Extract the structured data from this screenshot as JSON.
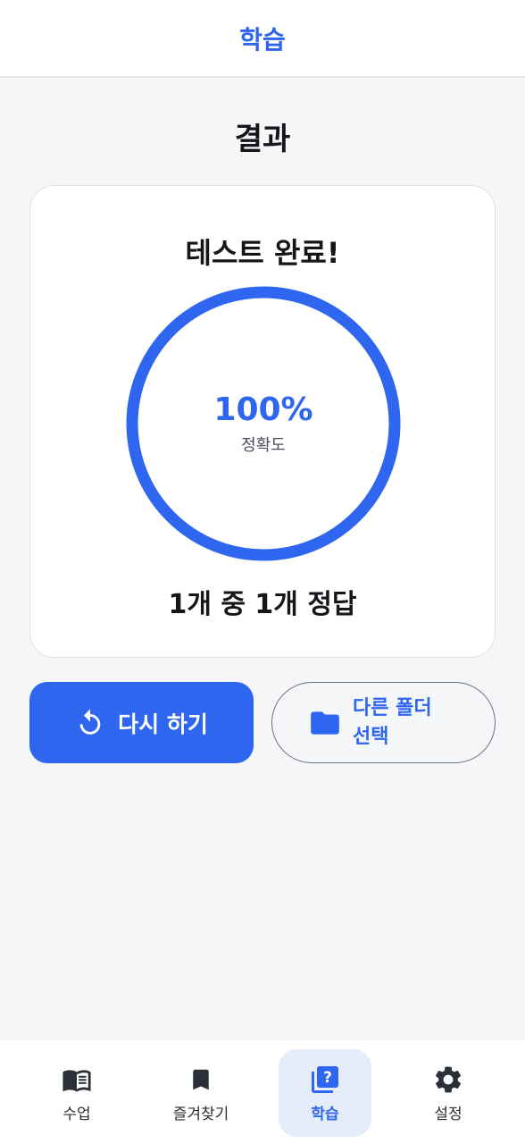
{
  "app_bar": {
    "title": "학습"
  },
  "page": {
    "heading": "결과"
  },
  "result_card": {
    "title": "테스트 완료!",
    "accuracy_text": "100%",
    "accuracy_caption": "정확도",
    "accuracy_fraction": 1.0,
    "score_text": "1개 중 1개 정답"
  },
  "actions": {
    "retry_label": "다시 하기",
    "retry_icon": "replay-icon",
    "folder_label": "다른 폴더 선택",
    "folder_icon": "folder-icon"
  },
  "bottom_nav": {
    "items": [
      {
        "label": "수업",
        "icon": "book-icon",
        "active": false
      },
      {
        "label": "즐겨찾기",
        "icon": "bookmark-icon",
        "active": false
      },
      {
        "label": "학습",
        "icon": "quiz-icon",
        "active": true
      },
      {
        "label": "설정",
        "icon": "gear-icon",
        "active": false
      }
    ]
  },
  "colors": {
    "accent": "#2f66f0",
    "background": "#f5f6f8",
    "active_nav_bg": "#e5edfb"
  }
}
